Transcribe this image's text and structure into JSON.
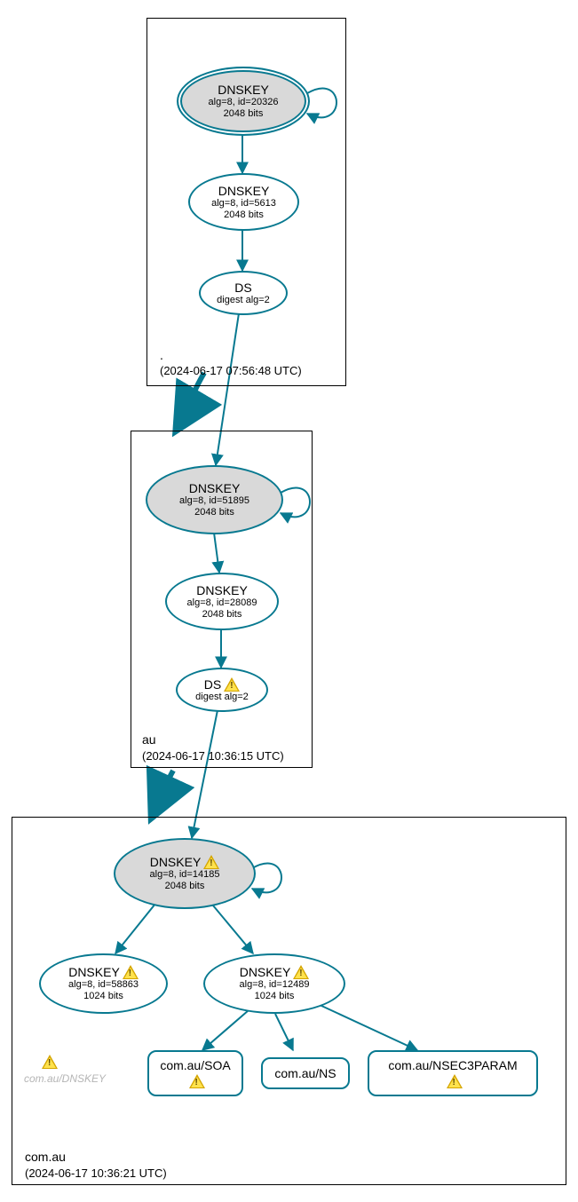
{
  "colors": {
    "stroke": "#087990",
    "ksk_fill": "#d9d9d9"
  },
  "zones": {
    "root": {
      "name": ".",
      "timestamp": "(2024-06-17 07:56:48 UTC)"
    },
    "au": {
      "name": "au",
      "timestamp": "(2024-06-17 10:36:15 UTC)"
    },
    "comau": {
      "name": "com.au",
      "timestamp": "(2024-06-17 10:36:21 UTC)"
    }
  },
  "nodes": {
    "root_ksk": {
      "title": "DNSKEY",
      "line2": "alg=8, id=20326",
      "line3": "2048 bits"
    },
    "root_zsk": {
      "title": "DNSKEY",
      "line2": "alg=8, id=5613",
      "line3": "2048 bits"
    },
    "root_ds": {
      "title": "DS",
      "line2": "digest alg=2"
    },
    "au_ksk": {
      "title": "DNSKEY",
      "line2": "alg=8, id=51895",
      "line3": "2048 bits"
    },
    "au_zsk": {
      "title": "DNSKEY",
      "line2": "alg=8, id=28089",
      "line3": "2048 bits"
    },
    "au_ds": {
      "title": "DS",
      "line2": "digest alg=2"
    },
    "comau_ksk": {
      "title": "DNSKEY",
      "line2": "alg=8, id=14185",
      "line3": "2048 bits"
    },
    "comau_zskL": {
      "title": "DNSKEY",
      "line2": "alg=8, id=58863",
      "line3": "1024 bits"
    },
    "comau_zskR": {
      "title": "DNSKEY",
      "line2": "alg=8, id=12489",
      "line3": "1024 bits"
    }
  },
  "rr": {
    "soa": {
      "label": "com.au/SOA"
    },
    "ns": {
      "label": "com.au/NS"
    },
    "nsec3": {
      "label": "com.au/NSEC3PARAM"
    }
  },
  "ghost": {
    "dnskey": "com.au/DNSKEY"
  }
}
